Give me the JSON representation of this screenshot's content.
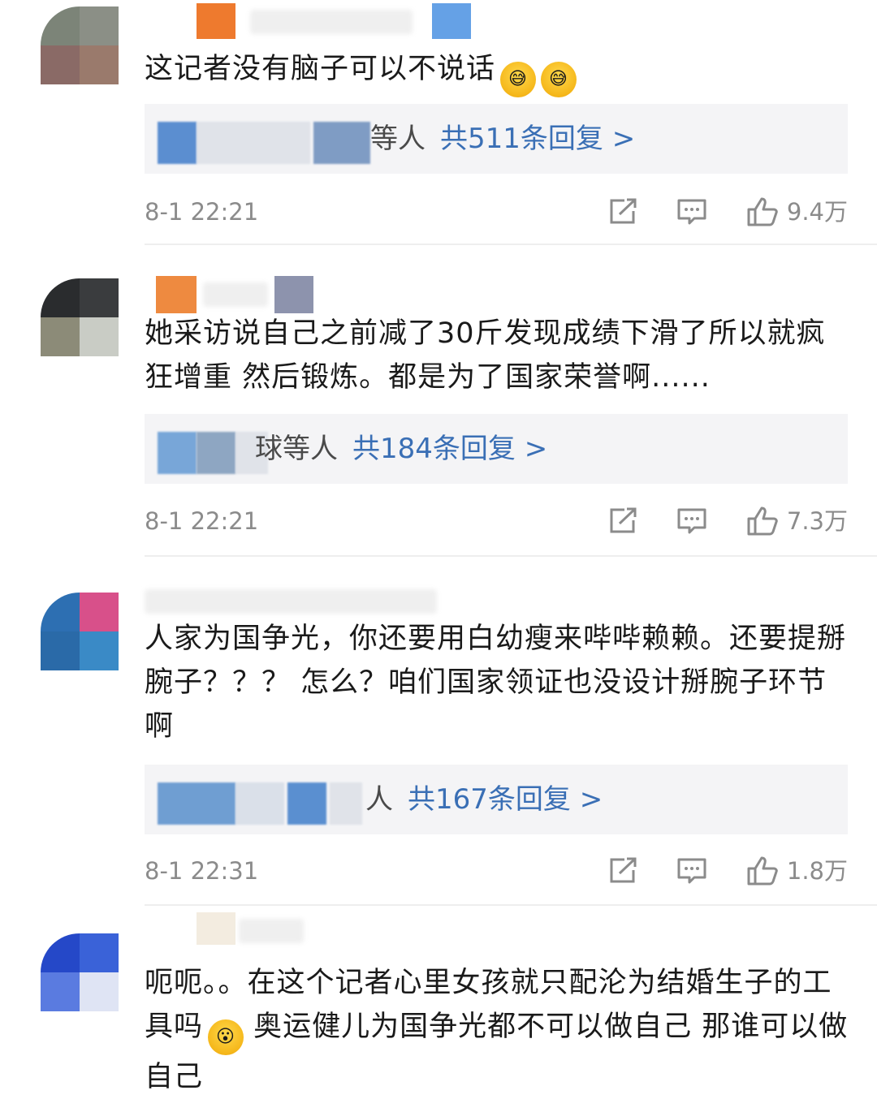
{
  "comments": [
    {
      "text": "这记者没有脑子可以不说话",
      "emojis": [
        "sweat-smile-emoji",
        "sweat-smile-emoji"
      ],
      "reply_who": "等人",
      "reply_link": "共511条回复 >",
      "time": "8-1 22:21",
      "likes": "9.4万"
    },
    {
      "text": "她采访说自己之前减了30斤发现成绩下滑了所以就疯狂增重 然后锻炼。都是为了国家荣誉啊......",
      "reply_who": "球等人",
      "reply_link": "共184条回复 >",
      "time": "8-1 22:21",
      "likes": "7.3万"
    },
    {
      "text": "人家为国争光，你还要用白幼瘦来哔哔赖赖。还要提掰腕子？？？ 怎么？咱们国家领证也没设计掰腕子环节啊",
      "reply_who": "人",
      "reply_link": "共167条回复 >",
      "time": "8-1 22:31",
      "likes": "1.8万"
    },
    {
      "text_before": "呃呃。。在这个记者心里女孩就只配沦为结婚生子的工具吗",
      "text_after": " 奥运健儿为国争光都不可以做自己 那谁可以做自己",
      "emoji": "thinking-emoji"
    }
  ],
  "colors": {
    "link": "#3a6fb5",
    "meta": "#8b8b8b",
    "reply_bg": "#f4f4f6"
  },
  "icons": [
    "share-icon",
    "comment-icon",
    "like-icon"
  ]
}
